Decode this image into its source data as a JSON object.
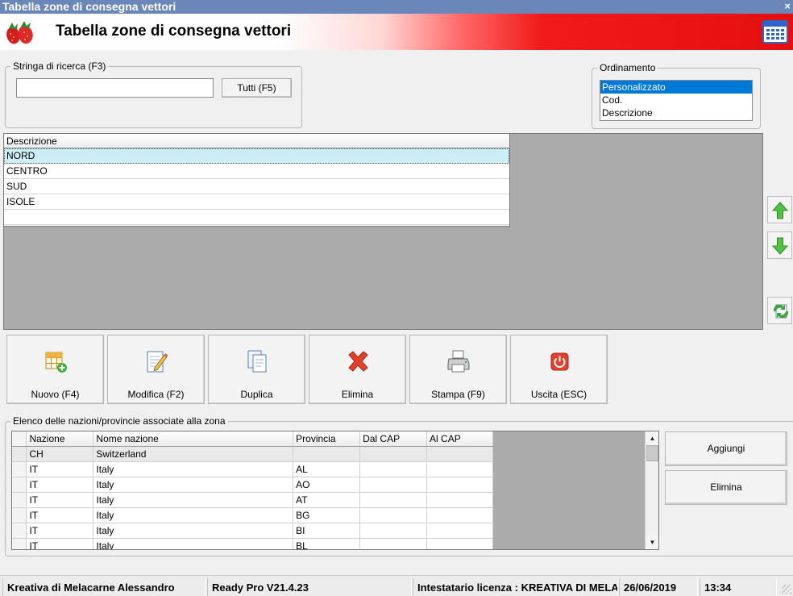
{
  "window": {
    "title": "Tabella zone di consegna vettori",
    "close_glyph": "×"
  },
  "header": {
    "title": "Tabella zone di consegna vettori",
    "logo_icon": "strawberry-icon",
    "calendar_icon": "calendar-icon"
  },
  "search": {
    "legend": "Stringa di ricerca (F3)",
    "value": "",
    "all_button": "Tutti (F5)"
  },
  "ordering": {
    "legend": "Ordinamento",
    "options": [
      "Personalizzato",
      "Cod.",
      "Descrizione"
    ],
    "selected": "Personalizzato"
  },
  "zones_grid": {
    "column": "Descrizione",
    "rows": [
      "NORD",
      "CENTRO",
      "SUD",
      "ISOLE"
    ],
    "selected_row": "NORD"
  },
  "side_buttons": {
    "up_icon": "arrow-up-icon",
    "down_icon": "arrow-down-icon",
    "refresh_icon": "refresh-icon"
  },
  "toolbar": {
    "new": "Nuovo (F4)",
    "edit": "Modifica (F2)",
    "duplicate": "Duplica",
    "delete": "Elimina",
    "print": "Stampa (F9)",
    "exit": "Uscita (ESC)"
  },
  "nations": {
    "legend": "Elenco delle nazioni/provincie associate alla zona",
    "columns": [
      "Nazione",
      "Nome nazione",
      "Provincia",
      "Dal CAP",
      "Al CAP"
    ],
    "rows": [
      [
        "CH",
        "Switzerland",
        "",
        "",
        ""
      ],
      [
        "IT",
        "Italy",
        "AL",
        "",
        ""
      ],
      [
        "IT",
        "Italy",
        "AO",
        "",
        ""
      ],
      [
        "IT",
        "Italy",
        "AT",
        "",
        ""
      ],
      [
        "IT",
        "Italy",
        "BG",
        "",
        ""
      ],
      [
        "IT",
        "Italy",
        "BI",
        "",
        ""
      ],
      [
        "IT",
        "Italy",
        "BL",
        "",
        ""
      ]
    ],
    "add_button": "Aggiungi",
    "delete_button": "Elimina"
  },
  "statusbar": {
    "company": "Kreativa di Melacarne Alessandro",
    "version": "Ready Pro V21.4.23",
    "license": "Intestatario licenza : KREATIVA DI MELACARNE ALESSANDRO",
    "date": "26/06/2019",
    "time": "13:34"
  },
  "colors": {
    "title_bar": "#6b86b8",
    "selection": "#0078d7",
    "row_highlight": "#cdeef5",
    "grid_background": "#ababab"
  }
}
